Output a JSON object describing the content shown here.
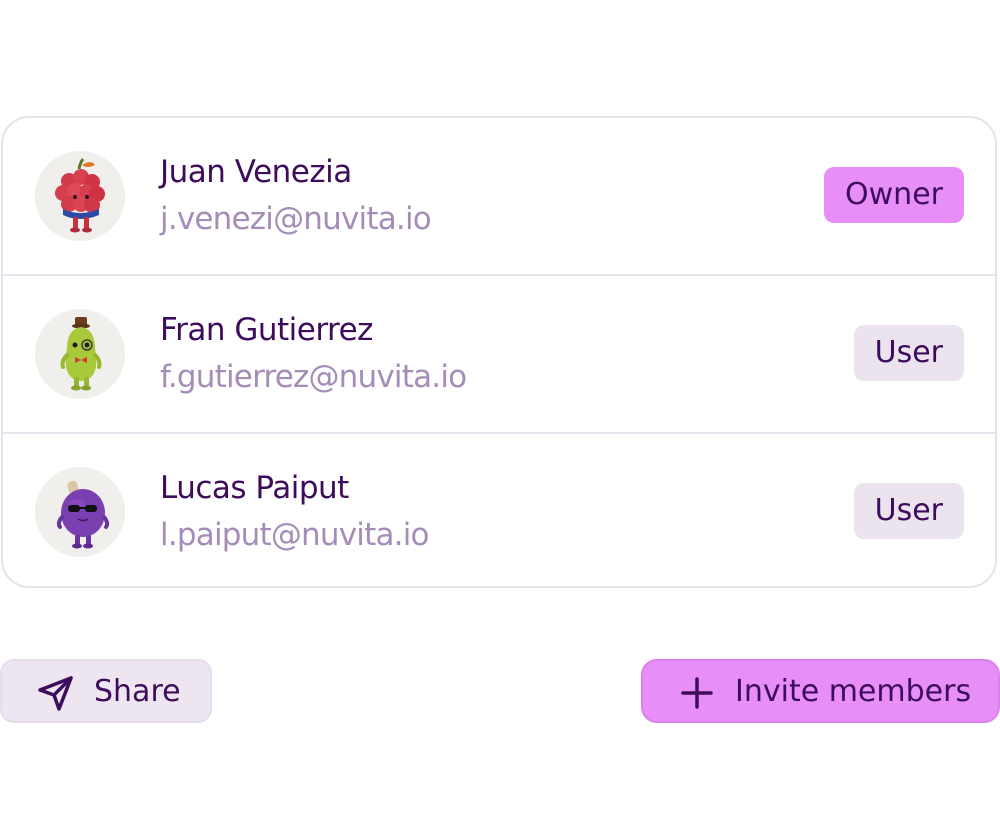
{
  "members": [
    {
      "name": "Juan Venezia",
      "email": "j.venezi@nuvita.io",
      "role": "Owner",
      "avatar_icon": "raspberry-character-avatar"
    },
    {
      "name": "Fran Gutierrez",
      "email": "f.gutierrez@nuvita.io",
      "role": "User",
      "avatar_icon": "pear-character-avatar"
    },
    {
      "name": "Lucas Paiput",
      "email": "l.paiput@nuvita.io",
      "role": "User",
      "avatar_icon": "plum-character-avatar"
    }
  ],
  "actions": {
    "share_label": "Share",
    "share_icon": "paper-plane-icon",
    "invite_label": "Invite members",
    "invite_icon": "plus-icon"
  },
  "colors": {
    "text_primary": "#3d0d5c",
    "text_secondary": "#a58db8",
    "accent": "#e88ef8",
    "badge_user": "#ebe4ef",
    "border": "#e7e1eb"
  }
}
